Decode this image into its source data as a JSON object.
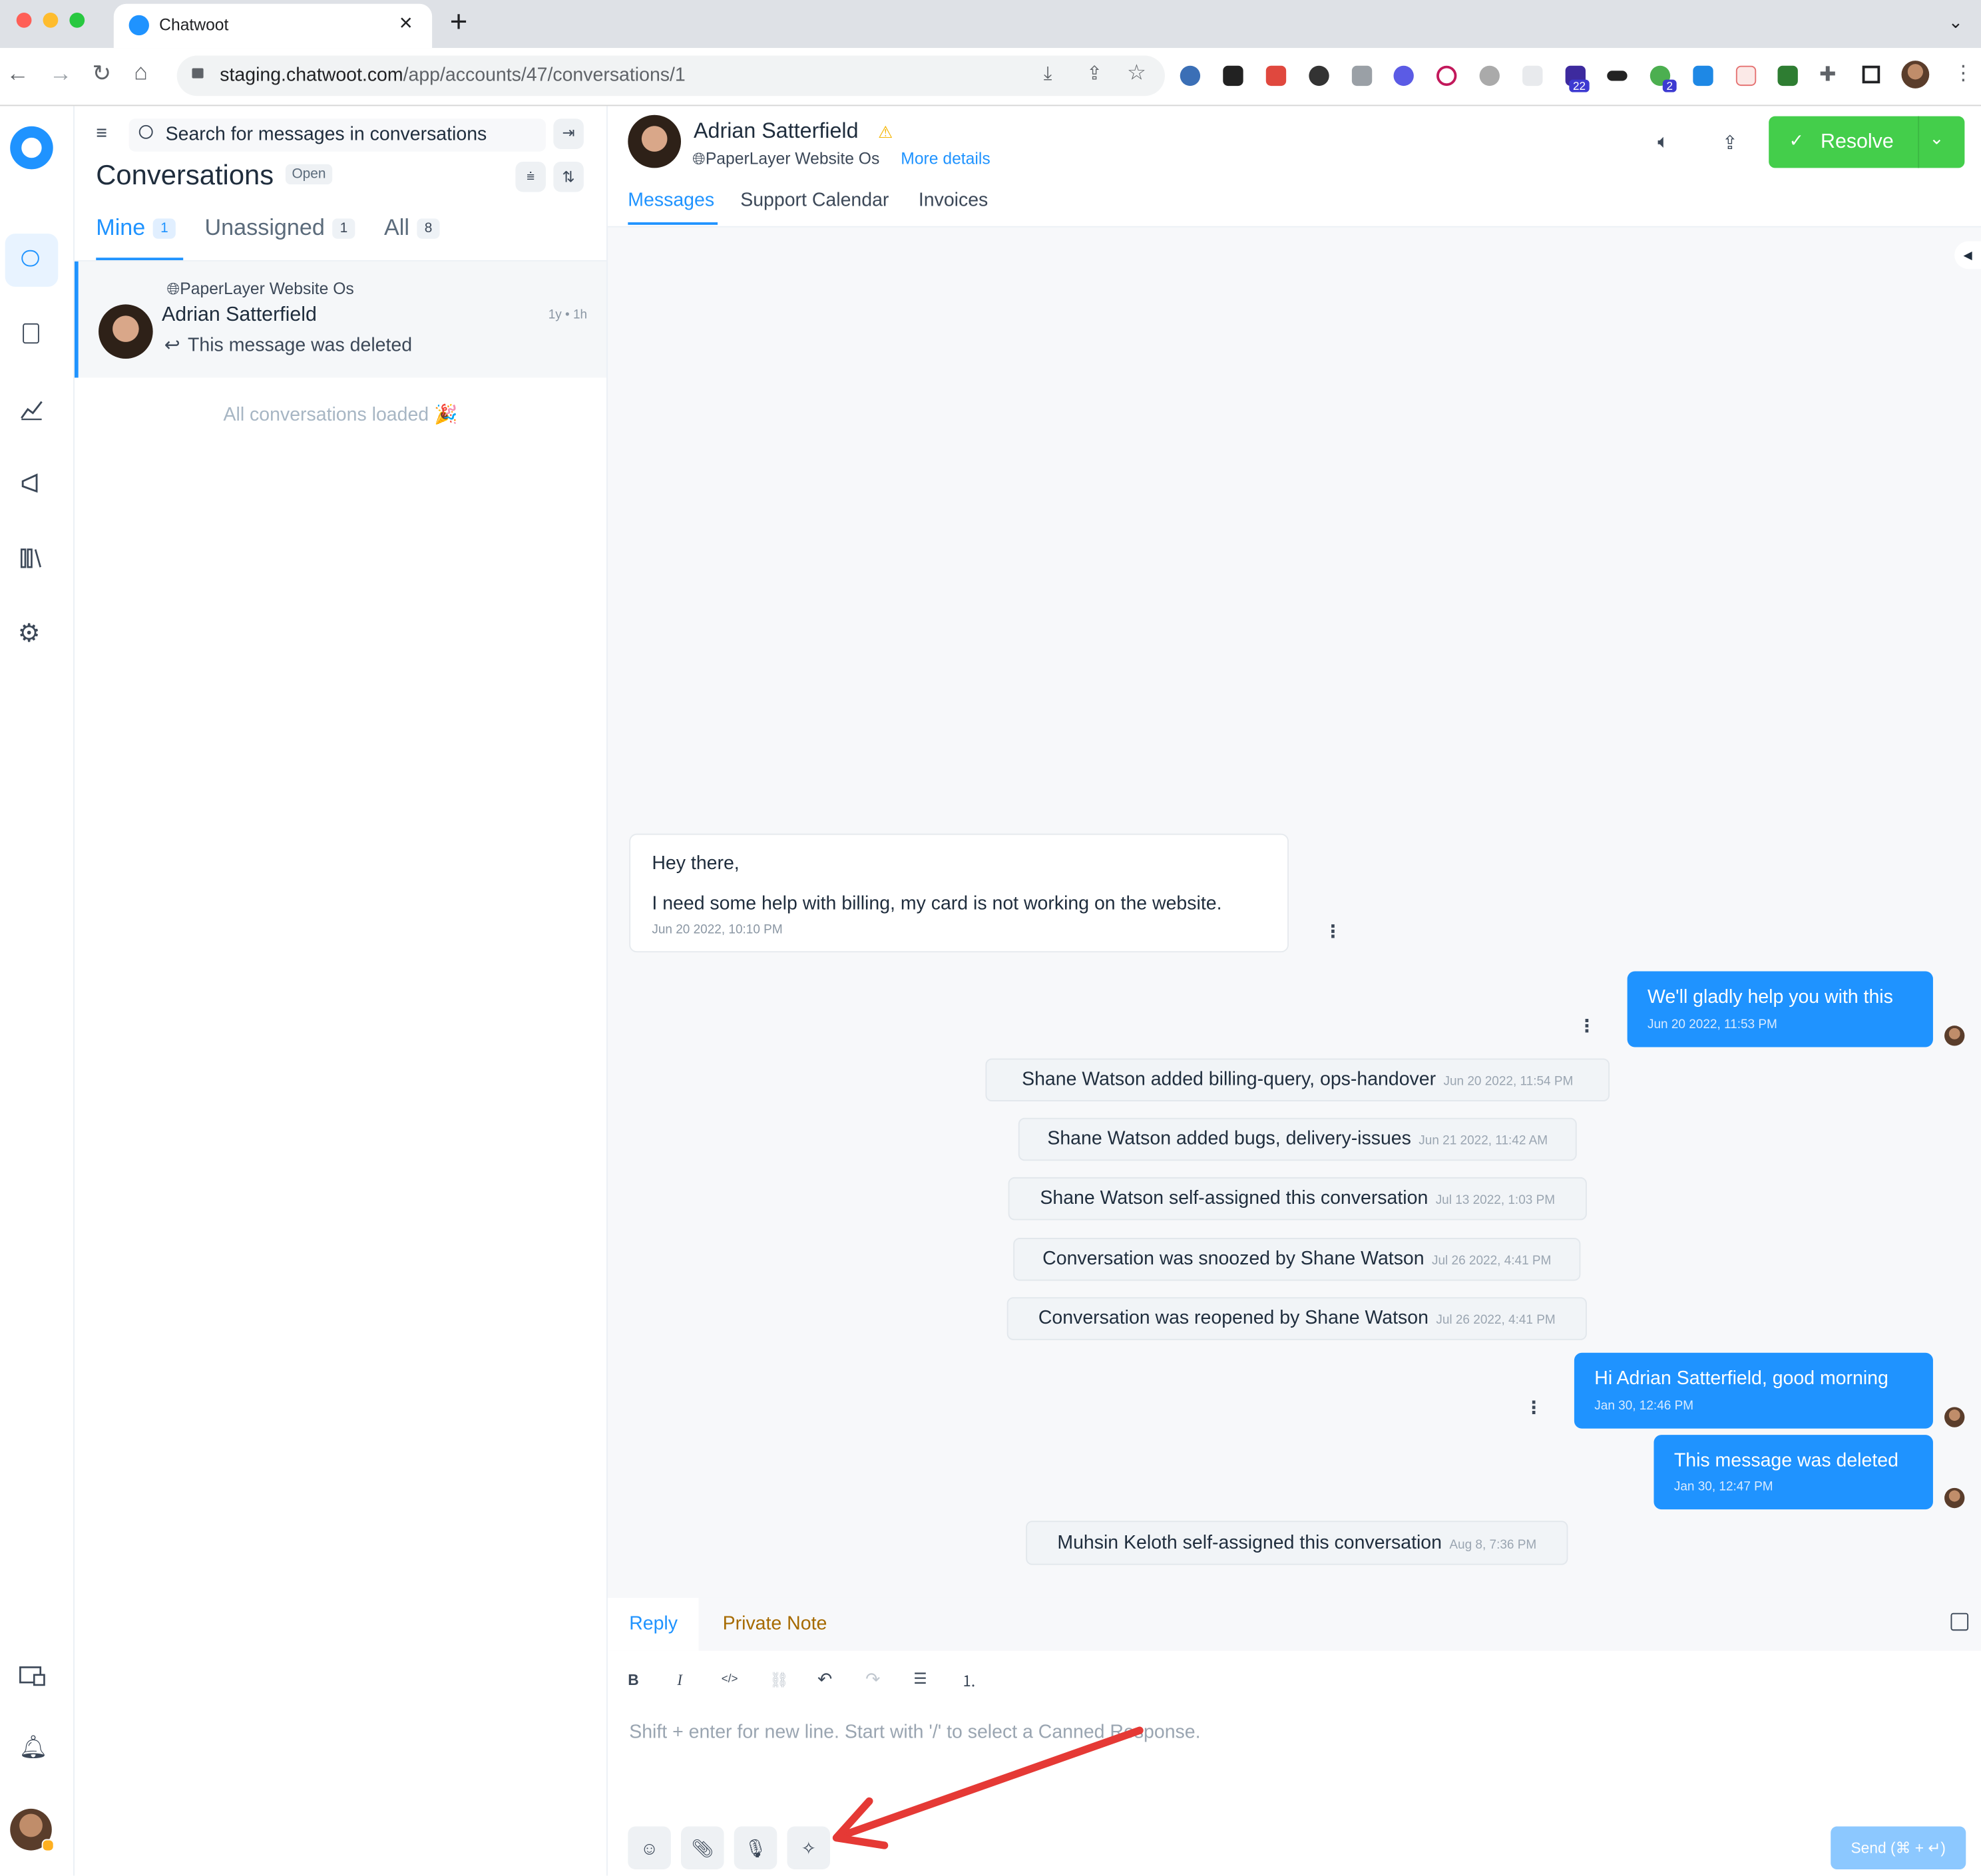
{
  "browser": {
    "tab_title": "Chatwoot",
    "close_glyph": "×",
    "new_tab_glyph": "+",
    "url_host": "staging.chatwoot.com",
    "url_path": "/app/accounts/47/conversations/1",
    "ext_badge_22": "22",
    "ext_badge_2": "2"
  },
  "search": {
    "placeholder": "Search for messages in conversations"
  },
  "conversations": {
    "title": "Conversations",
    "status_badge": "Open",
    "tabs": [
      {
        "label": "Mine",
        "count": "1"
      },
      {
        "label": "Unassigned",
        "count": "1"
      },
      {
        "label": "All",
        "count": "8"
      }
    ],
    "item": {
      "inbox": "PaperLayer Website Os",
      "name": "Adrian Satterfield",
      "time": "1y • 1h",
      "preview": "This message was deleted"
    },
    "footer": "All conversations loaded 🎉"
  },
  "header": {
    "name": "Adrian Satterfield",
    "inbox": "PaperLayer Website Os",
    "more_details": "More details",
    "resolve": "Resolve",
    "tabs": [
      "Messages",
      "Support Calendar",
      "Invoices"
    ]
  },
  "messages": {
    "incoming": {
      "line1": "Hey there,",
      "line2": "I need some help with billing, my card is not working on the website.",
      "time": "Jun 20 2022, 10:10 PM"
    },
    "out1": {
      "text": "We'll gladly help you with this",
      "time": "Jun 20 2022, 11:53 PM"
    },
    "activities": [
      {
        "text": "Shane Watson added billing-query, ops-handover",
        "time": "Jun 20 2022, 11:54 PM"
      },
      {
        "text": "Shane Watson added bugs, delivery-issues",
        "time": "Jun 21 2022, 11:42 AM"
      },
      {
        "text": "Shane Watson self-assigned this conversation",
        "time": "Jul 13 2022, 1:03 PM"
      },
      {
        "text": "Conversation was snoozed by Shane Watson",
        "time": "Jul 26 2022, 4:41 PM"
      },
      {
        "text": "Conversation was reopened by Shane Watson",
        "time": "Jul 26 2022, 4:41 PM"
      }
    ],
    "out2": {
      "text": "Hi Adrian Satterfield, good morning",
      "time": "Jan 30, 12:46 PM"
    },
    "out3": {
      "text": "This message was deleted",
      "time": "Jan 30, 12:47 PM"
    },
    "final_activity": {
      "text": "Muhsin Keloth self-assigned this conversation",
      "time": "Aug 8, 7:36 PM"
    }
  },
  "reply": {
    "tab_reply": "Reply",
    "tab_note": "Private Note",
    "placeholder": "Shift + enter for new line. Start with '/' to select a Canned Response.",
    "send": "Send (⌘ + ↵)"
  },
  "icons": {
    "bold": "B",
    "italic": "I",
    "code": "</>",
    "link": "⛓",
    "undo": "↶",
    "redo": "↷",
    "bullet": "☰",
    "numbered": "⒈"
  },
  "colors": {
    "primary": "#1f93ff",
    "resolve": "#44ce4b",
    "note": "#a66a00",
    "arrow": "#e53935"
  }
}
